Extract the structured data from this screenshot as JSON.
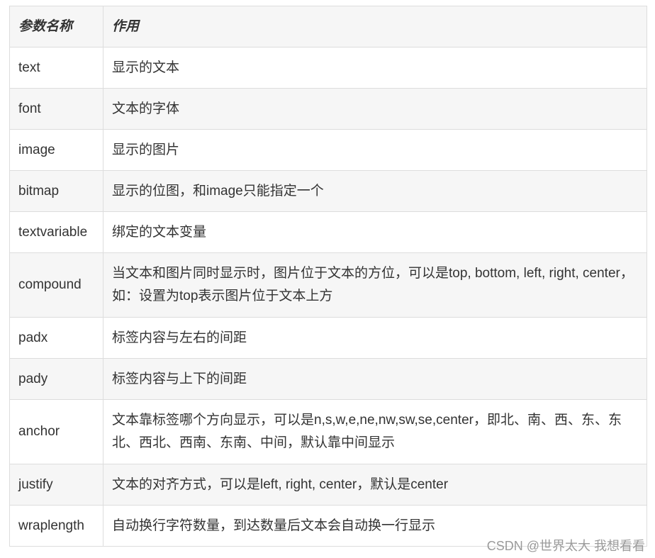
{
  "table": {
    "headers": [
      "参数名称",
      "作用"
    ],
    "rows": [
      {
        "name": "text",
        "description": "显示的文本"
      },
      {
        "name": "font",
        "description": "文本的字体"
      },
      {
        "name": "image",
        "description": "显示的图片"
      },
      {
        "name": "bitmap",
        "description": "显示的位图，和image只能指定一个"
      },
      {
        "name": "textvariable",
        "description": "绑定的文本变量"
      },
      {
        "name": "compound",
        "description": "当文本和图片同时显示时，图片位于文本的方位，可以是top, bottom, left, right, center，如：设置为top表示图片位于文本上方"
      },
      {
        "name": "padx",
        "description": "标签内容与左右的间距"
      },
      {
        "name": "pady",
        "description": "标签内容与上下的间距"
      },
      {
        "name": "anchor",
        "description": "文本靠标签哪个方向显示，可以是n,s,w,e,ne,nw,sw,se,center，即北、南、西、东、东北、西北、西南、东南、中间，默认靠中间显示"
      },
      {
        "name": "justify",
        "description": "文本的对齐方式，可以是left, right, center，默认是center"
      },
      {
        "name": "wraplength",
        "description": "自动换行字符数量，到达数量后文本会自动换一行显示"
      }
    ]
  },
  "watermark": "CSDN @世界太大 我想看看"
}
